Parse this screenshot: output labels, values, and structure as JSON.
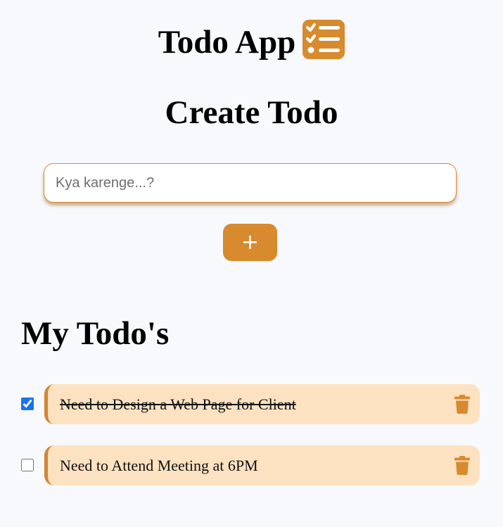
{
  "app": {
    "title": "Todo App",
    "logo_icon": "list-check-icon",
    "accent_color": "#d78a2e",
    "card_color": "#fde2c1",
    "background_color": "#f7f9fd"
  },
  "create": {
    "heading": "Create Todo",
    "input_placeholder": "Kya karenge...?",
    "input_value": "",
    "add_button_label": "+"
  },
  "list": {
    "heading": "My Todo's",
    "delete_icon": "trash-icon",
    "items": [
      {
        "text": "Need to Design a Web Page for Client",
        "completed": true
      },
      {
        "text": "Need to Attend Meeting at 6PM",
        "completed": false
      }
    ]
  }
}
